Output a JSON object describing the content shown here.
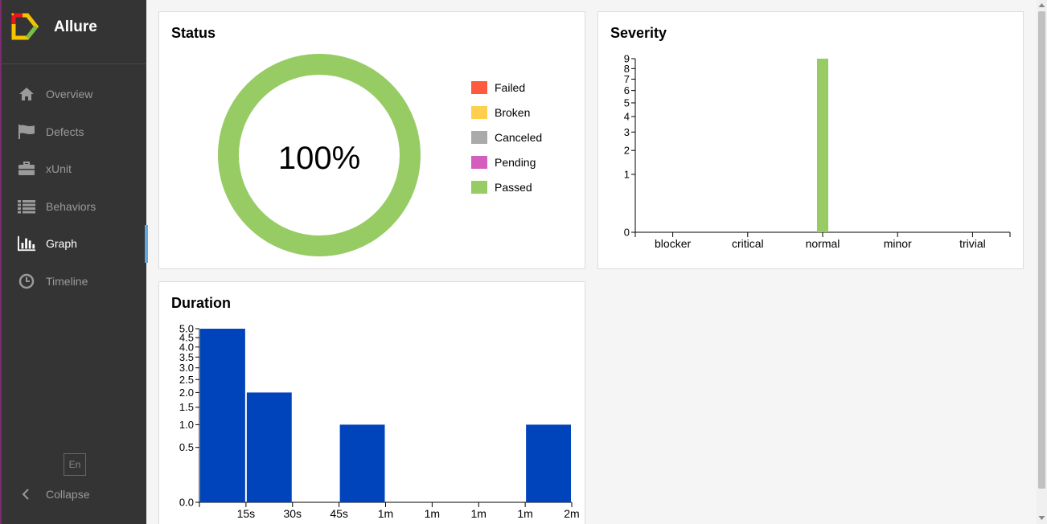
{
  "app": {
    "name": "Allure"
  },
  "sidebar": {
    "items": [
      {
        "label": "Overview",
        "icon": "home-icon"
      },
      {
        "label": "Defects",
        "icon": "flag-icon"
      },
      {
        "label": "xUnit",
        "icon": "briefcase-icon"
      },
      {
        "label": "Behaviors",
        "icon": "list-icon"
      },
      {
        "label": "Graph",
        "icon": "bar-chart-icon",
        "active": true
      },
      {
        "label": "Timeline",
        "icon": "clock-icon"
      }
    ],
    "language": "En",
    "collapse_label": "Collapse"
  },
  "colors": {
    "failed": "#fd5a3e",
    "broken": "#ffd050",
    "canceled": "#aaaaaa",
    "pending": "#d35ebe",
    "passed": "#97cc64",
    "duration_bar": "#0044bb"
  },
  "status": {
    "title": "Status",
    "center_text": "100%",
    "legend": [
      {
        "label": "Failed",
        "color": "#fd5a3e"
      },
      {
        "label": "Broken",
        "color": "#ffd050"
      },
      {
        "label": "Canceled",
        "color": "#aaaaaa"
      },
      {
        "label": "Pending",
        "color": "#d35ebe"
      },
      {
        "label": "Passed",
        "color": "#97cc64"
      }
    ]
  },
  "severity": {
    "title": "Severity"
  },
  "duration": {
    "title": "Duration"
  },
  "chart_data": [
    {
      "type": "pie",
      "title": "Status",
      "categories": [
        "Failed",
        "Broken",
        "Canceled",
        "Pending",
        "Passed"
      ],
      "values": [
        0,
        0,
        0,
        0,
        9
      ],
      "center_label": "100%",
      "legend_position": "right"
    },
    {
      "type": "bar",
      "title": "Severity",
      "categories": [
        "blocker",
        "critical",
        "normal",
        "minor",
        "trivial"
      ],
      "values": [
        0,
        0,
        9,
        0,
        0
      ],
      "y_scale": "sqrt",
      "yticks": [
        "0",
        "1",
        "2",
        "3",
        "4",
        "5",
        "6",
        "7",
        "8",
        "9"
      ],
      "ylim": [
        0,
        9
      ]
    },
    {
      "type": "bar",
      "title": "Duration",
      "categories": [
        "0s-15s",
        "15s-30s",
        "30s-45s",
        "45s-1m",
        "1m-1m",
        "1m-1m",
        "1m-1m",
        "1m-2m"
      ],
      "values": [
        5,
        2,
        0,
        1,
        0,
        0,
        0,
        1
      ],
      "xticks": [
        "15s",
        "30s",
        "45s",
        "1m",
        "1m",
        "1m",
        "1m",
        "2m"
      ],
      "y_scale": "sqrt",
      "yticks": [
        "0.0",
        "0.5",
        "1.0",
        "1.5",
        "2.0",
        "2.5",
        "3.0",
        "3.5",
        "4.0",
        "4.5",
        "5.0"
      ],
      "ylim": [
        0,
        5
      ]
    }
  ]
}
